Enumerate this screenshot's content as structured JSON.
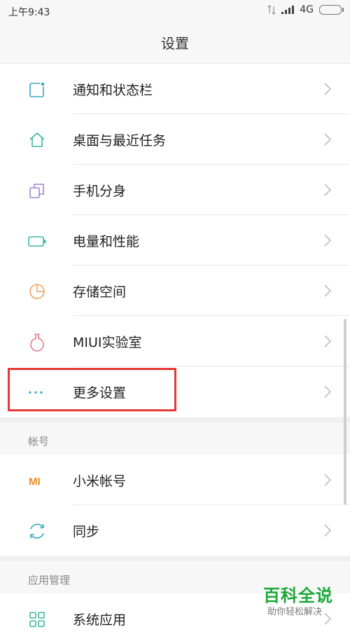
{
  "status_bar": {
    "time": "上午9:43",
    "network": "4G"
  },
  "title": "设置",
  "groups": [
    {
      "items": [
        {
          "label": "通知和状态栏"
        },
        {
          "label": "桌面与最近任务"
        },
        {
          "label": "手机分身"
        },
        {
          "label": "电量和性能"
        },
        {
          "label": "存储空间"
        },
        {
          "label": "MIUI实验室"
        },
        {
          "label": "更多设置"
        }
      ]
    },
    {
      "header": "帐号",
      "items": [
        {
          "label": "小米帐号",
          "icon_text": "MI"
        },
        {
          "label": "同步"
        }
      ]
    },
    {
      "header": "应用管理",
      "items": [
        {
          "label": "系统应用"
        }
      ]
    }
  ],
  "watermark": {
    "title": "百科全说",
    "subtitle": "助你轻松解决"
  },
  "colors": {
    "accent": "#1ca83a",
    "highlight": "#e53935"
  }
}
